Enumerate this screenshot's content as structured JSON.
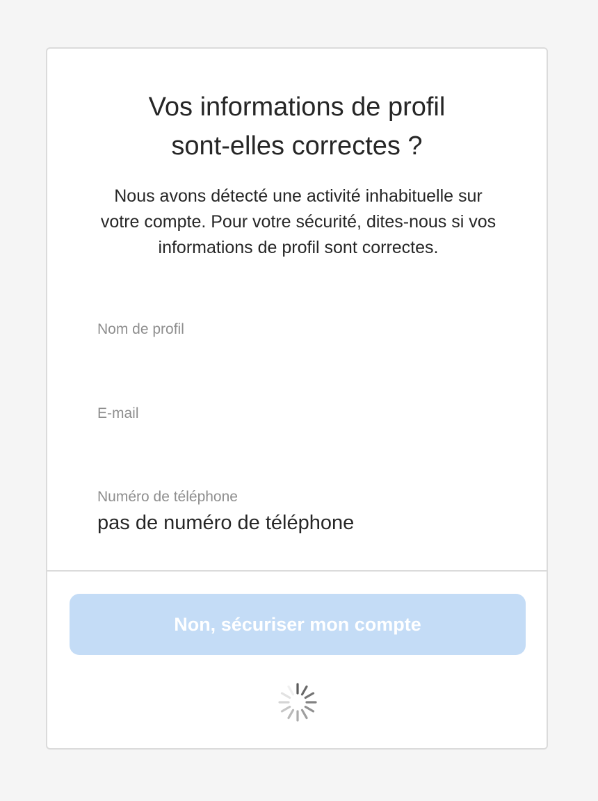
{
  "dialog": {
    "title_line1": "Vos informations de profil",
    "title_line2": "sont-elles correctes ?",
    "description": "Nous avons détecté une activité inhabituelle sur votre compte. Pour votre sécurité, dites-nous si vos informations de profil sont correctes."
  },
  "fields": {
    "profile_name": {
      "label": "Nom de profil",
      "value": ""
    },
    "email": {
      "label": "E-mail",
      "value": ""
    },
    "phone": {
      "label": "Numéro de téléphone",
      "value": "pas de numéro de téléphone"
    }
  },
  "actions": {
    "secure_button_label": "Non, sécuriser mon compte",
    "secure_button_color": "#c4dcf6",
    "loading_icon": "spinner-icon"
  },
  "colors": {
    "background": "#f5f5f5",
    "card": "#ffffff",
    "border": "#dbdbdb",
    "text_primary": "#262626",
    "text_secondary": "#8e8e8e"
  }
}
